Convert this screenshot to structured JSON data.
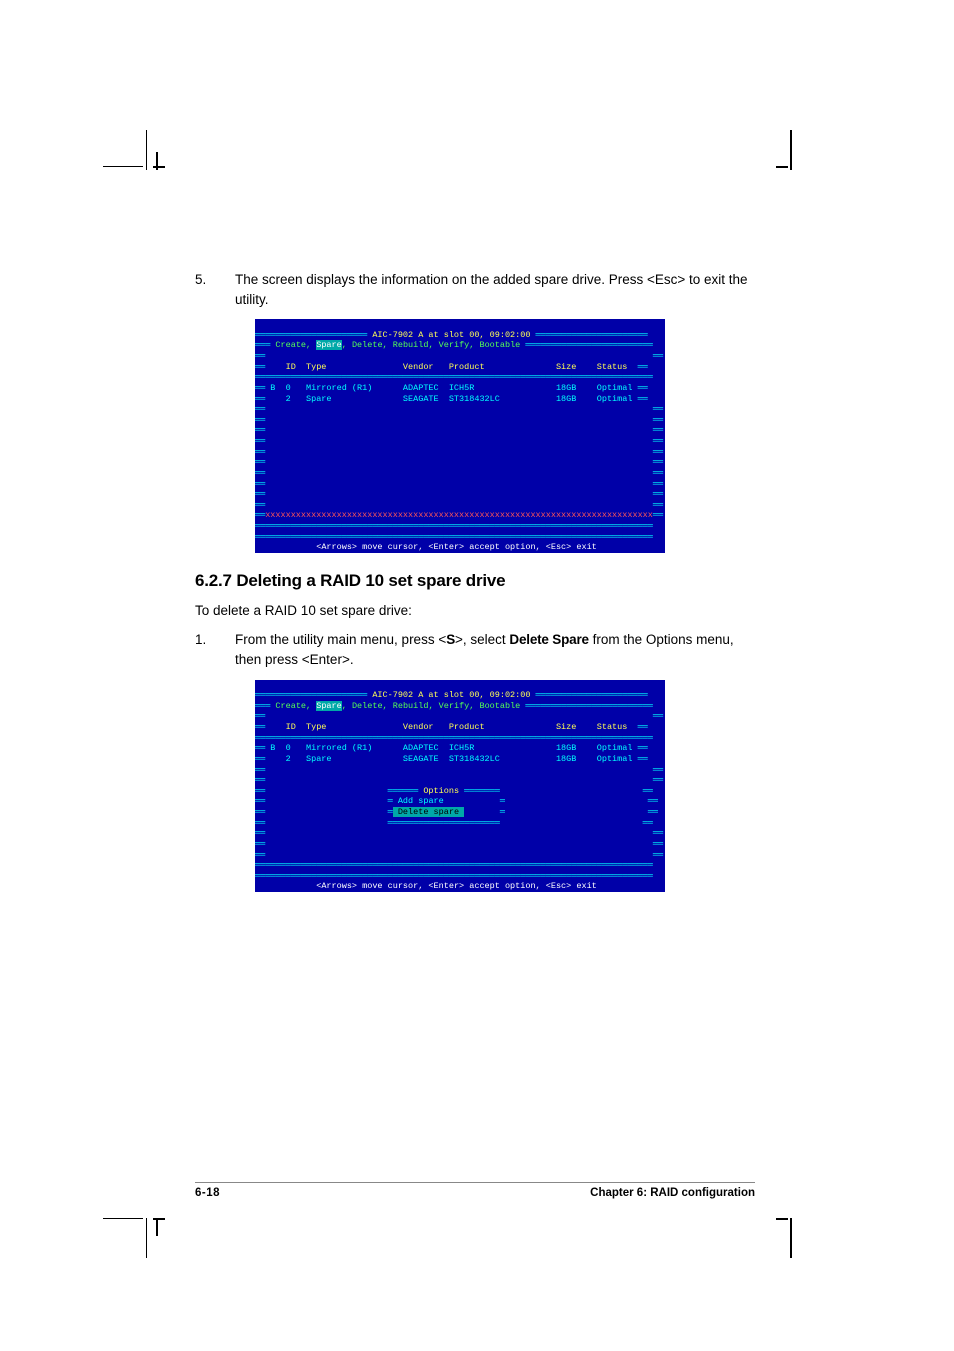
{
  "step5": {
    "num": "5.",
    "text_a": "The screen displays the information on the added spare drive. Press <Esc> to exit the utility."
  },
  "bios1": {
    "title": " AIC-7902 A at slot 00, 09:02:00 ",
    "menu_pre": " Create, ",
    "menu_sel": "Spare",
    "menu_post": ", Delete, Rebuild, Verify, Bootable ",
    "headers": "    ID  Type               Vendor   Product              Size    Status",
    "row1": " B  0   Mirrored (R1)      ADAPTEC  ICH5R                18GB    Optimal",
    "row2": "    2   Spare              SEAGATE  ST318432LC           18GB    Optimal",
    "xline": "xxxxxxxxxxxxxxxxxxxxxxxxxxxxxxxxxxxxxxxxxxxxxxxxxxxxxxxxxxxxxxxxxxxxxxxxxxxx",
    "help": "<Arrows> move cursor, <Enter> accept option, <Esc> exit"
  },
  "heading": "6.2.7   Deleting a RAID 10 set spare drive",
  "intro": "To delete a RAID 10 set spare drive:",
  "step1": {
    "num": "1.",
    "text_a": "From the utility main menu, press <",
    "text_b": "S",
    "text_c": ">, select ",
    "text_d": "Delete Spare",
    "text_e": " from the Options menu, then press <Enter>."
  },
  "bios2": {
    "title": " AIC-7902 A at slot 00, 09:02:00 ",
    "menu_pre": " Create, ",
    "menu_sel": "Spare",
    "menu_post": ", Delete, Rebuild, Verify, Bootable ",
    "headers": "    ID  Type               Vendor   Product              Size    Status",
    "row1": " B  0   Mirrored (R1)      ADAPTEC  ICH5R                18GB    Optimal",
    "row2": "    2   Spare              SEAGATE  ST318432LC           18GB    Optimal",
    "opt_title": " Options ",
    "opt1": " Add spare",
    "opt2": " Delete spare ",
    "help": "<Arrows> move cursor, <Enter> accept option, <Esc> exit"
  },
  "footer": {
    "left": "6-18",
    "right": "Chapter 6: RAID configuration"
  }
}
